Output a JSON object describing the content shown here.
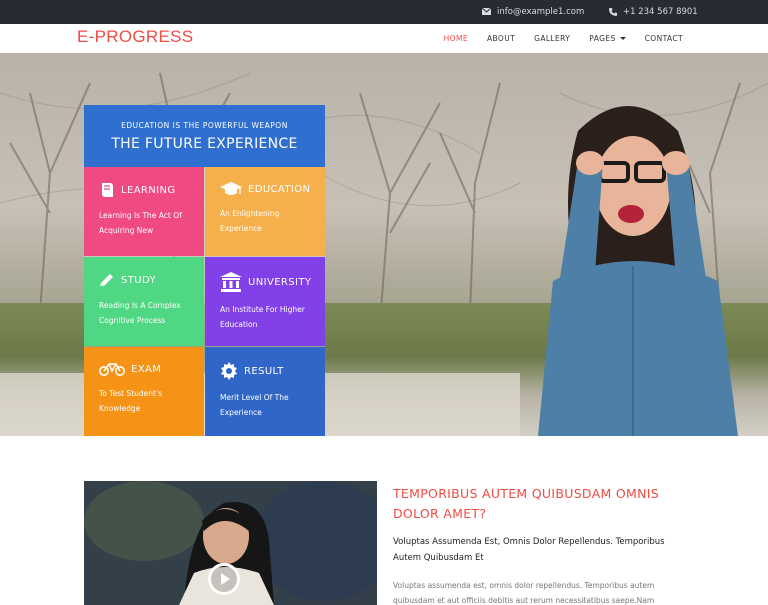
{
  "topbar": {
    "email": "info@example1.com",
    "phone": "+1 234 567 8901"
  },
  "header": {
    "logo": "E-PROGRESS",
    "nav": [
      "HOME",
      "ABOUT",
      "GALLERY",
      "PAGES",
      "CONTACT"
    ]
  },
  "panel": {
    "subtitle": "EDUCATION IS THE POWERFUL WEAPON",
    "title": "THE FUTURE EXPERIENCE",
    "items": [
      {
        "title": "LEARNING",
        "desc": "Learning Is The Act Of Acquiring New",
        "color": "#ef4a82",
        "icon": "book-icon"
      },
      {
        "title": "EDUCATION",
        "desc": "An Enlightening Experience",
        "color": "#f6b04b",
        "icon": "graduation-cap-icon"
      },
      {
        "title": "STUDY",
        "desc": "Reading Is A Complex Cognitive Process",
        "color": "#4fd783",
        "icon": "pencil-icon"
      },
      {
        "title": "UNIVERSITY",
        "desc": "An Institute For Higher Education",
        "color": "#8140e8",
        "icon": "university-icon"
      },
      {
        "title": "EXAM",
        "desc": "To Test Student's Knowledge",
        "color": "#f59317",
        "icon": "bicycle-icon"
      },
      {
        "title": "RESULT",
        "desc": "Merit Level Of The Experience",
        "color": "#2f66c8",
        "icon": "gear-icon"
      }
    ]
  },
  "about": {
    "heading": "TEMPORIBUS AUTEM QUIBUSDAM OMNIS DOLOR AMET?",
    "lead": "Voluptas Assumenda Est, Omnis Dolor Repellendus. Temporibus Autem Quibusdam Et",
    "body": "Voluptas assumenda est, omnis dolor repellendus. Temporibus autem quibusdam et aut officiis debitis aut rerum necessitatibus saepe.Nam"
  },
  "colors": {
    "accent": "#f04d45",
    "topbar": "#262b34",
    "panel_header": "#2f6fcf"
  }
}
